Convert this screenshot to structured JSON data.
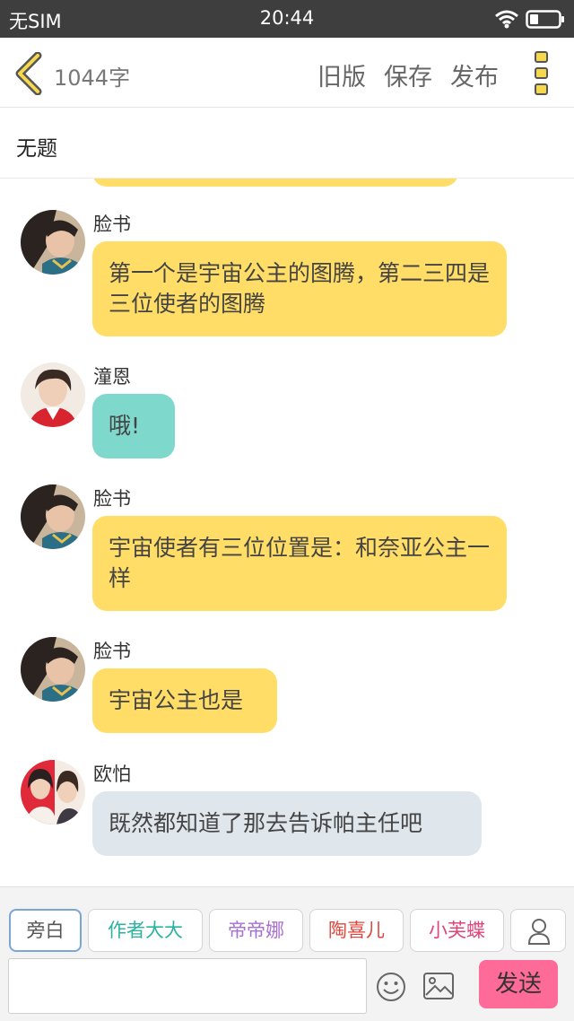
{
  "status_bar": {
    "carrier": "无SIM",
    "time": "20:44"
  },
  "nav": {
    "word_count": "1044字",
    "old_version": "旧版",
    "save": "保存",
    "publish": "发布"
  },
  "story": {
    "title": "无题"
  },
  "messages": [
    {
      "name": "脸书",
      "text": "第一个是宇宙公主的图腾，第二三四是三位使者的图腾",
      "bubble_color": "#ffdd66"
    },
    {
      "name": "潼恩",
      "text": "哦!",
      "bubble_color": "#7fd8cc"
    },
    {
      "name": "脸书",
      "text": "宇宙使者有三位位置是：和奈亚公主一样",
      "bubble_color": "#ffdd66"
    },
    {
      "name": "脸书",
      "text": "宇宙公主也是",
      "bubble_color": "#ffdd66"
    },
    {
      "name": "欧怕",
      "text": "既然都知道了那去告诉帕主任吧",
      "bubble_color": "#dfe6ec"
    }
  ],
  "roles": [
    {
      "label": "旁白",
      "color": "#555555"
    },
    {
      "label": "作者大大",
      "color": "#2bb3a0"
    },
    {
      "label": "帝帝娜",
      "color": "#a76fd0"
    },
    {
      "label": "陶喜儿",
      "color": "#e0463c"
    },
    {
      "label": "小芙蝶",
      "color": "#e0457a"
    }
  ],
  "composer": {
    "send_label": "发送",
    "input_value": ""
  },
  "icons": {
    "back": "chevron-left-icon",
    "menu": "more-vertical-icon",
    "wifi": "wifi-icon",
    "battery": "battery-icon",
    "emoji": "emoji-icon",
    "image": "image-icon",
    "person": "person-icon"
  },
  "colors": {
    "accent": "#f5d84e",
    "send": "#ff6b98"
  }
}
